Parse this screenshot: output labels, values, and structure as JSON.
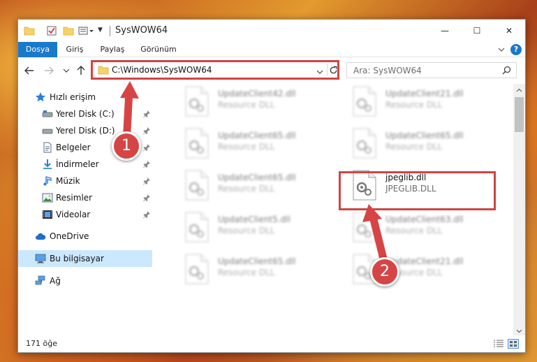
{
  "window": {
    "title": "SysWOW64",
    "minimize_glyph": "—",
    "maximize_glyph": "☐",
    "close_glyph": "✕"
  },
  "ribbon": {
    "tabs": [
      "Dosya",
      "Giriş",
      "Paylaş",
      "Görünüm"
    ],
    "help_glyph": "?"
  },
  "address": {
    "path": "C:\\Windows\\SysWOW64",
    "search_placeholder": "Ara: SysWOW64"
  },
  "nav_pane": {
    "items": [
      {
        "label": "Hızlı erişim",
        "icon": "star-icon",
        "pinned": false
      },
      {
        "label": "Yerel Disk (C:)",
        "icon": "drive-icon",
        "pinned": true
      },
      {
        "label": "Yerel Disk (D:)",
        "icon": "drive-icon",
        "pinned": true
      },
      {
        "label": "Belgeler",
        "icon": "document-icon",
        "pinned": true
      },
      {
        "label": "İndirmeler",
        "icon": "download-icon",
        "pinned": true
      },
      {
        "label": "Müzik",
        "icon": "music-icon",
        "pinned": true
      },
      {
        "label": "Resimler",
        "icon": "image-icon",
        "pinned": true
      },
      {
        "label": "Videolar",
        "icon": "video-icon",
        "pinned": true
      },
      {
        "label": "OneDrive",
        "icon": "cloud-icon",
        "pinned": false
      },
      {
        "label": "Bu bilgisayar",
        "icon": "computer-icon",
        "pinned": false,
        "selected": true
      },
      {
        "label": "Ağ",
        "icon": "network-icon",
        "pinned": false
      }
    ]
  },
  "files": [
    {
      "name": "UpdateClient42.dll",
      "type": "Resource DLL",
      "blurred": true
    },
    {
      "name": "UpdateClient21.dll",
      "type": "Resource DLL",
      "blurred": true
    },
    {
      "name": "UpdateClient65.dll",
      "type": "Resource DLL",
      "blurred": true
    },
    {
      "name": "UpdateClient65.dll",
      "type": "Resource DLL",
      "blurred": true
    },
    {
      "name": "UpdateClient65.dll",
      "type": "Resource DLL",
      "blurred": true
    },
    {
      "name": "jpeglib.dll",
      "type": "JPEGLIB.DLL",
      "blurred": false
    },
    {
      "name": "UpdateClient5.dll",
      "type": "Resource DLL",
      "blurred": true
    },
    {
      "name": "UpdateClient63.dll",
      "type": "Resource DLL",
      "blurred": true
    },
    {
      "name": "UpdateClient65.dll",
      "type": "Resource DLL",
      "blurred": true
    },
    {
      "name": "UpdateClient21.dll",
      "type": "Resource DLL",
      "blurred": true
    }
  ],
  "status": {
    "item_count": "171 öğe"
  },
  "annotations": {
    "badge_1": "1",
    "badge_2": "2",
    "highlight_color": "#d04444"
  },
  "colors": {
    "accent": "#1979ca",
    "selection": "#cce8ff",
    "annotation_red": "#d64545"
  }
}
